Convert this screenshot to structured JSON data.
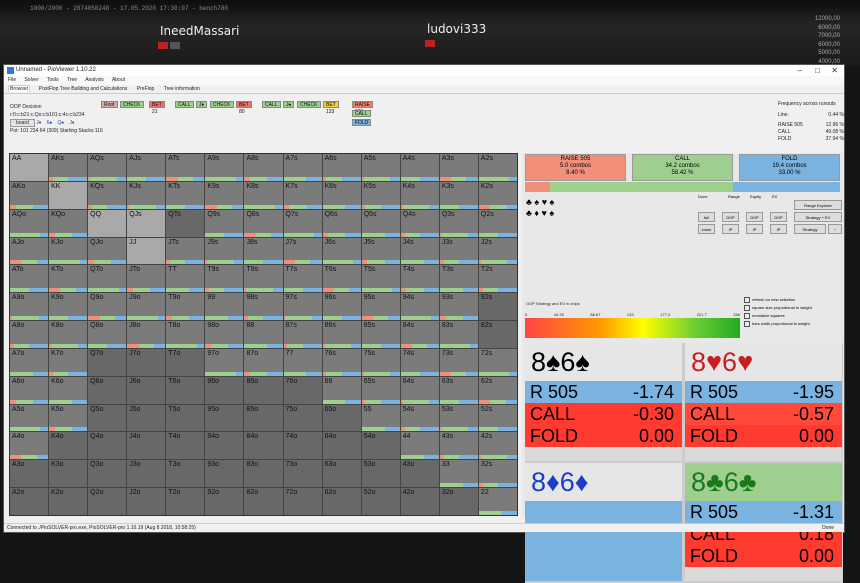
{
  "stream": {
    "header_text": "1000/2000 - 2874058248 - 17.05.2020 17:30:07 - bench780",
    "player1": "IneedMassari",
    "player2": "ludovi333",
    "stacks": [
      "12000,00",
      "6000,00",
      "7000,00",
      "6000,00",
      "5000,00",
      "4000,00",
      "3000,00"
    ]
  },
  "window": {
    "title": "Unnamed - PioViewer 1.10.22",
    "menu": [
      "File",
      "Solver",
      "Tools",
      "Tree",
      "Analysis",
      "About"
    ],
    "tabs": [
      "Browser",
      "PostFlop Tree Building and Calculations",
      "PreFlop",
      "Tree information"
    ],
    "decision_label": "OOP Decision",
    "path_text": "r:0:c:b21:c:Qs:c:b101:c:4c:c:b234",
    "board_label": "board",
    "arrows": [
      "J♦",
      "6♠",
      "Q♠",
      "J♦"
    ],
    "pot_text": "Pot: 101 234 64 (309) Starting Stacks:116",
    "status_left": "Connected to ./PioSOLVER-pro.exe, PioSOLVER-pro 1.10.19 (Aug 8 2018, 10:58:25)",
    "status_right": "Done"
  },
  "actionbar": [
    {
      "label": "Root",
      "color": "#d9a9a9"
    },
    {
      "label": "CHECK",
      "color": "#9fcf8f"
    },
    {
      "label": "BET 21",
      "color": "#f07070"
    },
    {
      "label": "CALL",
      "color": "#9fcf8f"
    },
    {
      "label": "J♦",
      "color": "#9fcf8f"
    },
    {
      "label": "CHECK",
      "color": "#9fcf8f"
    },
    {
      "label": "BET 80",
      "color": "#f07070"
    },
    {
      "label": "CALL",
      "color": "#9fcf8f"
    },
    {
      "label": "J♠",
      "color": "#9fcf8f"
    },
    {
      "label": "CHECK",
      "color": "#9fcf8f"
    },
    {
      "label": "BET 133",
      "color": "#f0d040"
    },
    {
      "label": "RAISE 505",
      "color": "#f08060"
    }
  ],
  "actionbar_sub": [
    {
      "label": "CALL",
      "color": "#9fcf8f"
    },
    {
      "label": "FOLD",
      "color": "#7ab3e0"
    }
  ],
  "frequency": {
    "title": "Frequency across runouts",
    "rows": [
      {
        "label": "Line:",
        "value": "0.44 %"
      },
      {
        "label": "RAISE 505",
        "value": "12.96 %"
      },
      {
        "label": "CALL",
        "value": "49.08 %"
      },
      {
        "label": "FOLD",
        "value": "37.94 %"
      }
    ]
  },
  "grid": {
    "cells": [
      [
        "AA",
        "AKs",
        "AQs",
        "AJs",
        "ATs",
        "A9s",
        "A8s",
        "A7s",
        "A6s",
        "A5s",
        "A4s",
        "A3s",
        "A2s"
      ],
      [
        "AKo",
        "KK",
        "KQs",
        "KJs",
        "KTs",
        "K9s",
        "K8s",
        "K7s",
        "K6s",
        "K5s",
        "K4s",
        "K3s",
        "K2s"
      ],
      [
        "AQo",
        "KQo",
        "QQ",
        "QJs",
        "QTs",
        "Q9s",
        "Q8s",
        "Q7s",
        "Q6s",
        "Q5s",
        "Q4s",
        "Q3s",
        "Q2s"
      ],
      [
        "AJo",
        "KJo",
        "QJo",
        "JJ",
        "JTs",
        "J9s",
        "J8s",
        "J7s",
        "J6s",
        "J5s",
        "J4s",
        "J3s",
        "J2s"
      ],
      [
        "ATo",
        "KTo",
        "QTo",
        "JTo",
        "TT",
        "T9s",
        "T8s",
        "T7s",
        "T6s",
        "T5s",
        "T4s",
        "T3s",
        "T2s"
      ],
      [
        "A9o",
        "K9o",
        "Q9o",
        "J9o",
        "T9o",
        "99",
        "98s",
        "97s",
        "96s",
        "95s",
        "94s",
        "93s",
        "92s"
      ],
      [
        "A8o",
        "K8o",
        "Q8o",
        "J8o",
        "T8o",
        "98o",
        "88",
        "87s",
        "86s",
        "85s",
        "84s",
        "83s",
        "82s"
      ],
      [
        "A7o",
        "K7o",
        "Q7o",
        "J7o",
        "T7o",
        "97o",
        "87o",
        "77",
        "76s",
        "75s",
        "74s",
        "73s",
        "72s"
      ],
      [
        "A6o",
        "K6o",
        "Q6o",
        "J6o",
        "T6o",
        "96o",
        "86o",
        "76o",
        "66",
        "65s",
        "64s",
        "63s",
        "62s"
      ],
      [
        "A5o",
        "K5o",
        "Q5o",
        "J5o",
        "T5o",
        "95o",
        "85o",
        "75o",
        "65o",
        "55",
        "54s",
        "53s",
        "52s"
      ],
      [
        "A4o",
        "K4o",
        "Q4o",
        "J4o",
        "T4o",
        "94o",
        "84o",
        "74o",
        "64o",
        "54o",
        "44",
        "43s",
        "42s"
      ],
      [
        "A3o",
        "K3o",
        "Q3o",
        "J3o",
        "T3o",
        "93o",
        "83o",
        "73o",
        "63o",
        "53o",
        "43o",
        "33",
        "32s"
      ],
      [
        "A2o",
        "K2o",
        "Q2o",
        "J2o",
        "T2o",
        "92o",
        "82o",
        "72o",
        "62o",
        "52o",
        "42o",
        "32o",
        "22"
      ]
    ],
    "active": [
      "AKs",
      "AQs",
      "AJs",
      "ATs",
      "A9s",
      "A8s",
      "A7s",
      "A6s",
      "A5s",
      "A4s",
      "A3s",
      "A2s",
      "AKo",
      "KQs",
      "KJs",
      "KTs",
      "K9s",
      "K8s",
      "K7s",
      "K6s",
      "K5s",
      "K4s",
      "K3s",
      "K2s",
      "AQo",
      "KQo",
      "Q9s",
      "Q8s",
      "Q7s",
      "Q6s",
      "Q5s",
      "Q4s",
      "Q3s",
      "Q2s",
      "AJo",
      "KJo",
      "QJo",
      "JTs",
      "J9s",
      "J8s",
      "J7s",
      "J6s",
      "J5s",
      "J4s",
      "J3s",
      "J2s",
      "ATo",
      "KTo",
      "QTo",
      "JTo",
      "TT",
      "T9s",
      "T8s",
      "T7s",
      "T6s",
      "T5s",
      "T4s",
      "T3s",
      "T2s",
      "A9o",
      "K9o",
      "Q9o",
      "J9o",
      "T9o",
      "99",
      "98s",
      "97s",
      "96s",
      "95s",
      "94s",
      "93s",
      "A8o",
      "K8o",
      "Q8o",
      "J8o",
      "T8o",
      "98o",
      "88",
      "87s",
      "86s",
      "85s",
      "84s",
      "83s",
      "A7o",
      "K7o",
      "97o",
      "87o",
      "77",
      "76s",
      "75s",
      "74s",
      "73s",
      "72s",
      "A6o",
      "K6o",
      "66",
      "65s",
      "64s",
      "63s",
      "62s",
      "A5o",
      "K5o",
      "55",
      "54s",
      "53s",
      "52s",
      "A4o",
      "44",
      "43s",
      "42s",
      "33",
      "32s",
      "22"
    ]
  },
  "summary": [
    {
      "label": "RAISE 505",
      "combos": "5.0 combos",
      "pct": "8.40 %",
      "color": "#f0907a"
    },
    {
      "label": "CALL",
      "combos": "34.2 combos",
      "pct": "58.42 %",
      "color": "#9fcf8f"
    },
    {
      "label": "FOLD",
      "combos": "19.4 combos",
      "pct": "33.00 %",
      "color": "#7ab3e0"
    }
  ],
  "panel": {
    "suits": [
      "♣ ♠ ♥ ♠",
      "♣ ♦ ♥ ♠"
    ],
    "ctrl_labels": [
      "Done",
      "Range",
      "Equity",
      "EV"
    ],
    "buttons": [
      "full",
      "OOP",
      "OOP",
      "OOP",
      "zoom",
      "IP",
      "IP",
      "IP"
    ],
    "side_buttons": [
      "Range Explorer",
      "Strategy + EV",
      "Strategy"
    ],
    "checkboxes": [
      "refresh on new selection",
      "square size proportional to weight",
      "normalize squares",
      "bars width proportional to weight"
    ],
    "gradient_title": "OOP Strategy and EV in chips",
    "gradient_ticks": [
      "0",
      "44.33",
      "88.67",
      "133",
      "177.3",
      "221.7",
      "266"
    ]
  },
  "combos": [
    {
      "hand": "8♠6♠",
      "color": "#000",
      "rows": [
        [
          "R 505",
          "-1.74"
        ],
        [
          "CALL",
          "-0.30"
        ],
        [
          "FOLD",
          "0.00"
        ]
      ]
    },
    {
      "hand": "8♥6♥",
      "color": "#c81e1e",
      "rows": [
        [
          "R 505",
          "-1.95"
        ],
        [
          "CALL",
          "-0.57"
        ],
        [
          "FOLD",
          "0.00"
        ]
      ]
    },
    {
      "hand": "8♦6♦",
      "color": "#1a3ec8",
      "rows": []
    },
    {
      "hand": "8♣6♣",
      "color": "#1a7a1a",
      "rows": [
        [
          "R 505",
          "-1.31"
        ],
        [
          "CALL",
          "0.18"
        ],
        [
          "FOLD",
          "0.00"
        ]
      ]
    }
  ]
}
